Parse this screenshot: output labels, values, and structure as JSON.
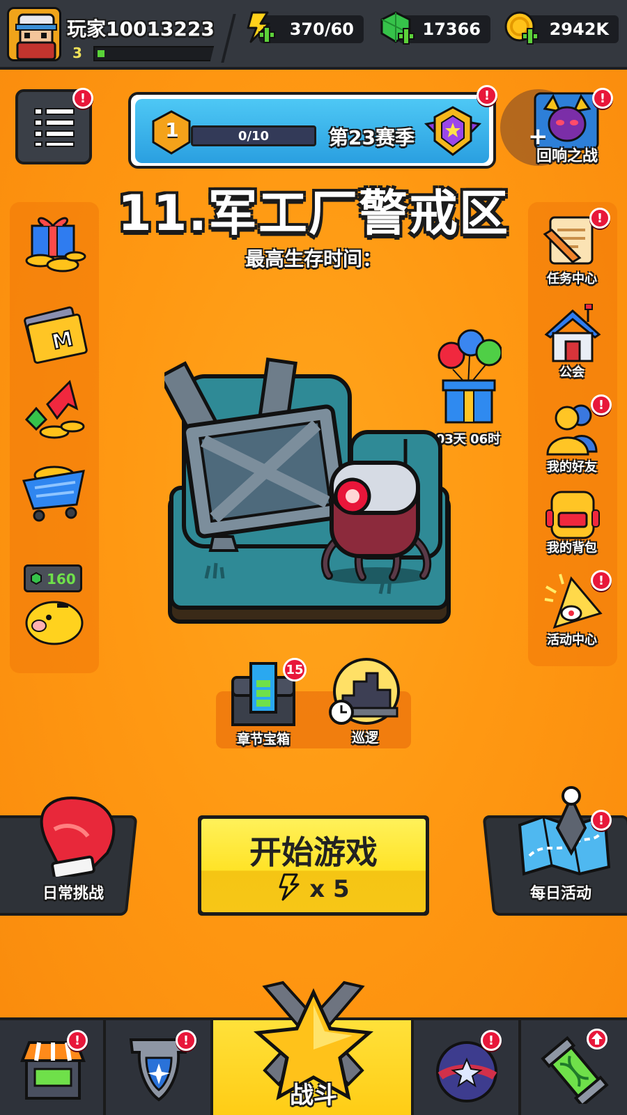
{
  "player": {
    "name": "玩家10013223",
    "level": "3",
    "xp_fraction": 0.06
  },
  "resources": {
    "energy": "370/60",
    "gems": "17366",
    "gold": "2942K"
  },
  "season": {
    "rank": "1",
    "progress": "0/10",
    "label": "第23赛季"
  },
  "echo_battle": {
    "label": "回响之战"
  },
  "stage": {
    "title": "11.军工厂警戒区",
    "survival_label": "最高生存时间："
  },
  "left_menu": {
    "piggy_value": "160"
  },
  "right_menu": [
    {
      "label": "任务中心",
      "badge": "!"
    },
    {
      "label": "公会",
      "badge": ""
    },
    {
      "label": "我的好友",
      "badge": "!"
    },
    {
      "label": "我的背包",
      "badge": ""
    },
    {
      "label": "活动中心",
      "badge": "!"
    }
  ],
  "gift": {
    "timer": "03天 06时"
  },
  "chapter": {
    "chest_label": "章节宝箱",
    "chest_count": "15",
    "patrol_label": "巡逻"
  },
  "buttons": {
    "daily_challenge": "日常挑战",
    "start": "开始游戏",
    "cost": "x 5",
    "daily_activity": "每日活动"
  },
  "nav": {
    "battle": "战斗"
  },
  "badge_mark": "!"
}
